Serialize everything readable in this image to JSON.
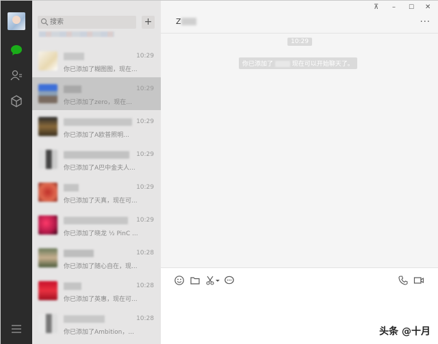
{
  "search": {
    "placeholder": "搜索"
  },
  "list": {
    "add_label": "+",
    "items": [
      {
        "time": "10:29",
        "preview": "你已添加了糊图图，现在..."
      },
      {
        "time": "10:29",
        "preview": "你已添加了zero，现在..."
      },
      {
        "time": "10:29",
        "preview": "你已添加了A欧普照明..."
      },
      {
        "time": "10:29",
        "preview": "你已添加了A巴中金夫人..."
      },
      {
        "time": "10:29",
        "preview": "你已添加了天真，现在可..."
      },
      {
        "time": "10:29",
        "preview": "你已添加了晓龙 ½ PinC ..."
      },
      {
        "time": "10:28",
        "preview": "你已添加了随心自在，现..."
      },
      {
        "time": "10:28",
        "preview": "你已添加了英惠，现在可..."
      },
      {
        "time": "10:28",
        "preview": "你已添加了Ambition，..."
      }
    ]
  },
  "chat": {
    "title": "Z",
    "more": "···",
    "timestamp": "10:29",
    "system_prefix": "你已添加了",
    "system_suffix": "现在可以开始聊天了。"
  },
  "window": {
    "pin": "⊼",
    "minimize": "–",
    "maximize": "☐",
    "close": "✕"
  },
  "watermark": "头条 @十月",
  "colors": {
    "accent_green": "#1aad19",
    "nav_bg": "#2b2b2b",
    "list_bg": "#e6e5e5",
    "chat_bg": "#f5f5f5"
  }
}
